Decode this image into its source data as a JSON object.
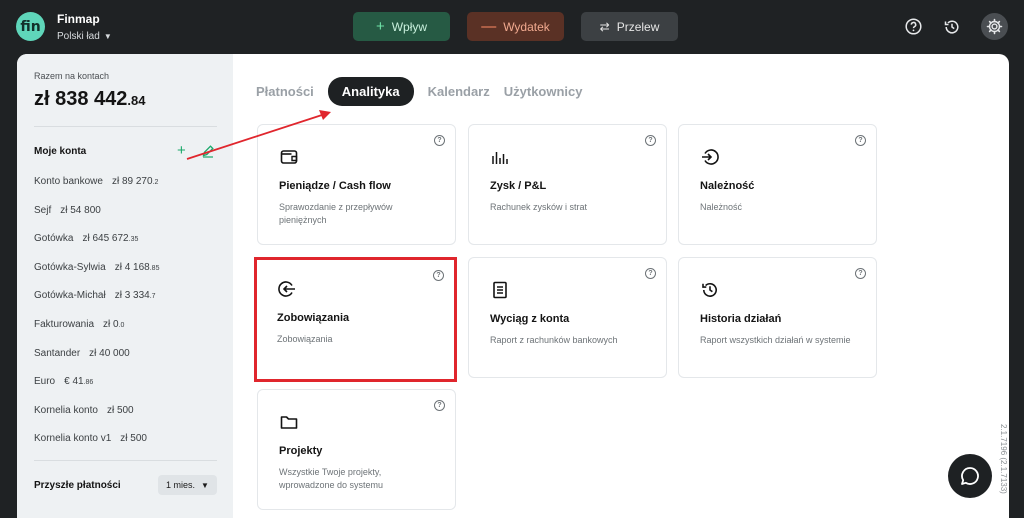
{
  "brand": {
    "logo_text": "fin",
    "name": "Finmap",
    "subtitle": "Polski ład"
  },
  "topbar": {
    "inflow_label": "Wpływ",
    "expense_label": "Wydatek",
    "transfer_label": "Przelew",
    "icons": [
      "help-icon",
      "history-icon",
      "settings-icon"
    ]
  },
  "sidebar": {
    "total_label": "Razem na kontach",
    "total_main": "zł 838 442",
    "total_dec": ".84",
    "accounts_title": "Moje konta",
    "accounts": [
      {
        "name": "Konto bankowe",
        "value": "zł 89 270",
        "dec": ".2"
      },
      {
        "name": "Sejf",
        "value": "zł 54 800",
        "dec": ""
      },
      {
        "name": "Gotówka",
        "value": "zł 645 672",
        "dec": ".35"
      },
      {
        "name": "Gotówka-Sylwia",
        "value": "zł 4 168",
        "dec": ".85"
      },
      {
        "name": "Gotówka-Michał",
        "value": "zł 3 334",
        "dec": ".7"
      },
      {
        "name": "Fakturowania",
        "value": "zł 0",
        "dec": ".0"
      },
      {
        "name": "Santander",
        "value": "zł 40 000",
        "dec": ""
      },
      {
        "name": "Euro",
        "value": "€ 41",
        "dec": ".86"
      },
      {
        "name": "Kornelia konto",
        "value": "zł 500",
        "dec": ""
      },
      {
        "name": "Kornelia konto v1",
        "value": "zł 500",
        "dec": ""
      }
    ],
    "future_title": "Przyszłe płatności",
    "period_value": "1 mies."
  },
  "tabs": [
    {
      "label": "Płatności",
      "active": false
    },
    {
      "label": "Analityka",
      "active": true
    },
    {
      "label": "Kalendarz",
      "active": false
    },
    {
      "label": "Użytkownicy",
      "active": false
    }
  ],
  "cards": [
    {
      "icon": "wallet-icon",
      "title": "Pieniądze / Cash flow",
      "desc": "Sprawozdanie z przepływów pieniężnych"
    },
    {
      "icon": "bar-chart-icon",
      "title": "Zysk / P&L",
      "desc": "Rachunek zysków i strat"
    },
    {
      "icon": "login-arrow-icon",
      "title": "Należność",
      "desc": "Należność"
    },
    {
      "icon": "logout-arrow-icon",
      "title": "Zobowiązania",
      "desc": "Zobowiązania"
    },
    {
      "icon": "document-icon",
      "title": "Wyciąg z konta",
      "desc": "Raport z rachunków bankowych"
    },
    {
      "icon": "history-icon",
      "title": "Historia działań",
      "desc": "Raport wszystkich działań w systemie"
    },
    {
      "icon": "folder-icon",
      "title": "Projekty",
      "desc": "Wszystkie Twoje projekty, wprowadzone do systemu"
    }
  ],
  "misc": {
    "help_glyph": "?",
    "version": "2.1.7196 (2.1.7133)",
    "accent_color": "#5fd6ba",
    "highlight_color": "#e0262d"
  }
}
